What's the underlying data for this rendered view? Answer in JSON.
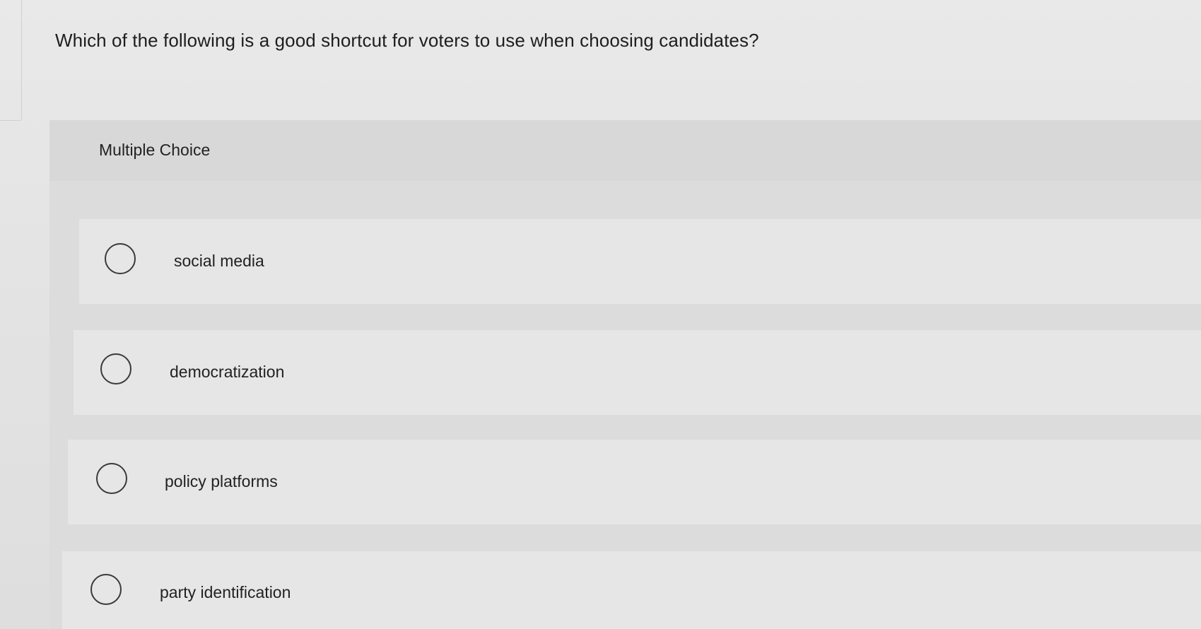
{
  "question": {
    "text": "Which of the following is a good shortcut for voters to use when choosing candidates?"
  },
  "multiple_choice": {
    "label": "Multiple Choice",
    "options": [
      {
        "label": "social media",
        "selected": false
      },
      {
        "label": "democratization",
        "selected": false
      },
      {
        "label": "policy platforms",
        "selected": false
      },
      {
        "label": "party identification",
        "selected": false
      }
    ]
  }
}
